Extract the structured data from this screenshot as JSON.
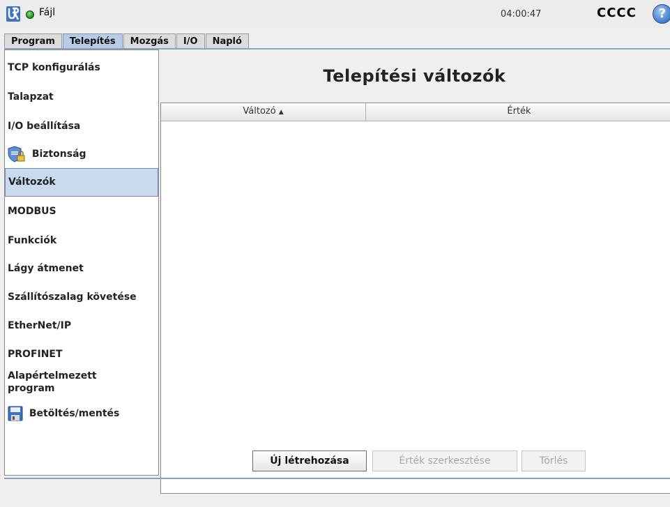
{
  "topbar": {
    "file_label": "Fájl",
    "clock": "04:00:47",
    "robot_name": "CCCC",
    "help_glyph": "?"
  },
  "tabs": [
    {
      "label": "Program",
      "active": false
    },
    {
      "label": "Telepítés",
      "active": true
    },
    {
      "label": "Mozgás",
      "active": false
    },
    {
      "label": "I/O",
      "active": false
    },
    {
      "label": "Napló",
      "active": false
    }
  ],
  "sidebar": {
    "items": [
      {
        "label": "TCP konfigurálás"
      },
      {
        "label": "Talapzat"
      },
      {
        "label": "I/O beállítása"
      },
      {
        "label": "Biztonság",
        "icon": "shield-lock-icon"
      },
      {
        "label": "Változók",
        "selected": true
      },
      {
        "label": "MODBUS"
      },
      {
        "label": "Funkciók"
      },
      {
        "label": "Lágy átmenet"
      },
      {
        "label": "Szállítószalag követése"
      },
      {
        "label": "EtherNet/IP"
      },
      {
        "label": "PROFINET"
      },
      {
        "label": "Alapértelmezett program"
      },
      {
        "label": "Betöltés/mentés",
        "icon": "floppy-disk-icon"
      }
    ]
  },
  "main": {
    "title": "Telepítési változók",
    "table": {
      "columns": [
        "Változó",
        "Érték"
      ],
      "sort_indicator": "▲",
      "rows": []
    },
    "buttons": {
      "create": "Új létrehozása",
      "edit": "Érték szerkesztése",
      "delete": "Törlés"
    }
  },
  "colors": {
    "accent": "#b9cce6",
    "selection": "#c9d9ee",
    "status_ok": "#2e9e2e"
  }
}
